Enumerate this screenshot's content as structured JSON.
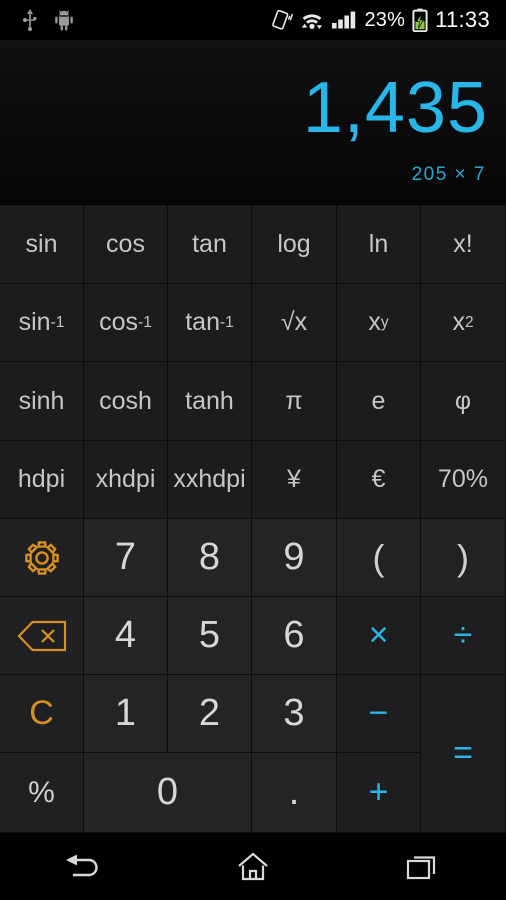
{
  "status_bar": {
    "icons_left": [
      "usb-icon",
      "android-debug-icon"
    ],
    "icons_right": [
      "vibrate-icon",
      "wifi-icon",
      "signal-icon"
    ],
    "battery_percent": "23%",
    "battery_icon": "battery-charging-icon",
    "clock": "11:33"
  },
  "display": {
    "result": "1,435",
    "expression": "205 × 7"
  },
  "colors": {
    "accent_cyan": "#29b6e8",
    "accent_orange": "#d6901f",
    "key_bg": "#202022",
    "screen_bg": "#0a0a0b"
  },
  "keypad": {
    "rows": [
      [
        {
          "label": "sin",
          "name": "key-sin"
        },
        {
          "label": "cos",
          "name": "key-cos"
        },
        {
          "label": "tan",
          "name": "key-tan"
        },
        {
          "label": "log",
          "name": "key-log"
        },
        {
          "label": "ln",
          "name": "key-ln"
        },
        {
          "label": "x!",
          "name": "key-factorial"
        }
      ],
      [
        {
          "label": "sin-1",
          "name": "key-asin"
        },
        {
          "label": "cos-1",
          "name": "key-acos"
        },
        {
          "label": "tan-1",
          "name": "key-atan"
        },
        {
          "label": "√x",
          "name": "key-sqrt"
        },
        {
          "label": "x^y",
          "name": "key-power"
        },
        {
          "label": "x^2",
          "name": "key-square"
        }
      ],
      [
        {
          "label": "sinh",
          "name": "key-sinh"
        },
        {
          "label": "cosh",
          "name": "key-cosh"
        },
        {
          "label": "tanh",
          "name": "key-tanh"
        },
        {
          "label": "π",
          "name": "key-pi"
        },
        {
          "label": "e",
          "name": "key-e"
        },
        {
          "label": "φ",
          "name": "key-phi"
        }
      ],
      [
        {
          "label": "hdpi",
          "name": "key-hdpi"
        },
        {
          "label": "xhdpi",
          "name": "key-xhdpi"
        },
        {
          "label": "xxhdpi",
          "name": "key-xxhdpi"
        },
        {
          "label": "¥",
          "name": "key-yen"
        },
        {
          "label": "€",
          "name": "key-euro"
        },
        {
          "label": "70%",
          "name": "key-70-percent"
        }
      ]
    ],
    "bases": {
      "sin_inv": "sin",
      "cos_inv": "cos",
      "tan_inv": "tan",
      "x_pow": "x",
      "x_sq": "x"
    },
    "exponents": {
      "minus_one": "-1",
      "y": "y",
      "two": "2"
    },
    "settings_label": "settings-gear",
    "backspace_label": "backspace",
    "clear_label": "C",
    "percent_label": "%",
    "digits": {
      "seven": "7",
      "eight": "8",
      "nine": "9",
      "four": "4",
      "five": "5",
      "six": "6",
      "one": "1",
      "two": "2",
      "three": "3",
      "zero": "0",
      "dot": "."
    },
    "operators": {
      "open_paren": "(",
      "close_paren": ")",
      "multiply": "×",
      "divide": "÷",
      "minus": "−",
      "plus": "+",
      "equals": "="
    }
  },
  "nav_bar": {
    "back": "back-icon",
    "home": "home-icon",
    "recents": "recents-icon"
  }
}
